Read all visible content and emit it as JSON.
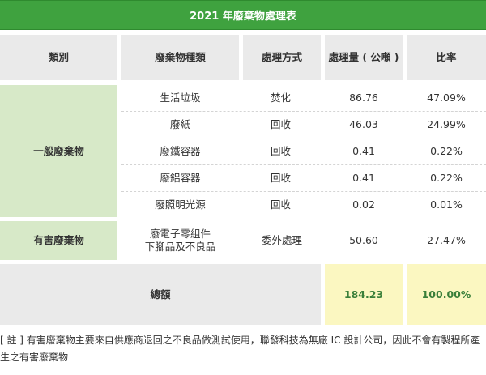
{
  "table": {
    "title": "2021 年廢棄物處理表",
    "headers": {
      "category": "類別",
      "type": "廢棄物種類",
      "method": "處理方式",
      "amount": "處理量 ( 公噸 )",
      "ratio": "比率"
    },
    "categories": {
      "general": "一般廢棄物",
      "hazardous": "有害廢棄物"
    },
    "rows": [
      {
        "type": "生活垃圾",
        "method": "焚化",
        "amount": "86.76",
        "ratio": "47.09%"
      },
      {
        "type": "廢紙",
        "method": "回收",
        "amount": "46.03",
        "ratio": "24.99%"
      },
      {
        "type": "廢鐵容器",
        "method": "回收",
        "amount": "0.41",
        "ratio": "0.22%"
      },
      {
        "type": "廢鋁容器",
        "method": "回收",
        "amount": "0.41",
        "ratio": "0.22%"
      },
      {
        "type": "廢照明光源",
        "method": "回收",
        "amount": "0.02",
        "ratio": "0.01%"
      },
      {
        "type_line1": "廢電子零組件",
        "type_line2": "下腳品及不良品",
        "method": "委外處理",
        "amount": "50.60",
        "ratio": "27.47%"
      }
    ],
    "total": {
      "label": "總額",
      "amount": "184.23",
      "ratio": "100.00%"
    }
  },
  "note": "[ 註 ] 有害廢棄物主要來自供應商退回之不良品做測試使用，聯發科技為無廠 IC 設計公司，因此不會有製程所產生之有害廢棄物",
  "colors": {
    "title_bg": "#3fa23f",
    "category_bg": "#d7e9c8",
    "header_bg": "#eaeaea",
    "total_highlight_bg": "#fbf7c1",
    "total_highlight_text": "#3a7f3a"
  }
}
